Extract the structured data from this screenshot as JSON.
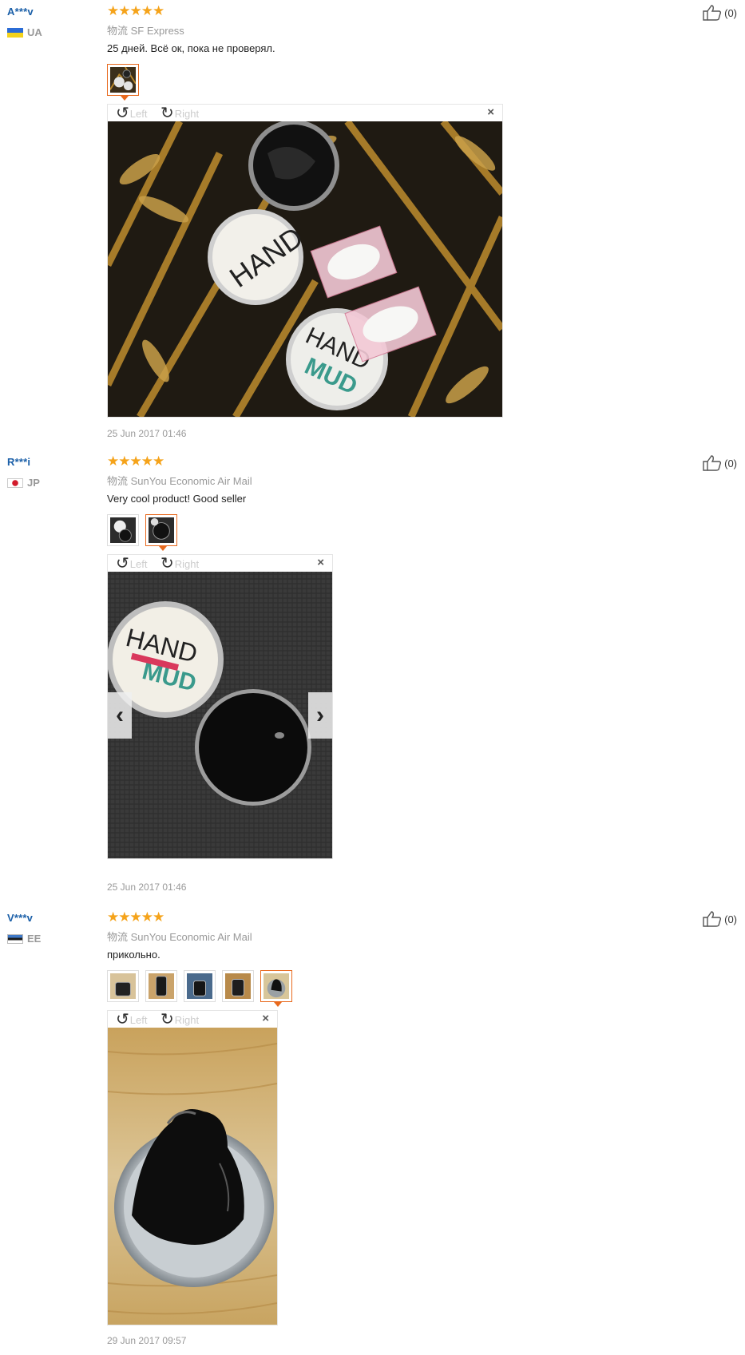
{
  "reviews": [
    {
      "user": "A***v",
      "country_code": "UA",
      "stars": "★★★★★",
      "logistics": "物流 SF Express",
      "comment": "25 дней. Всё ок, пока не проверял.",
      "date": "25 Jun 2017 01:46",
      "likes": "(0)",
      "thumbnail_count": 1,
      "active_thumbnail": 1
    },
    {
      "user": "R***i",
      "country_code": "JP",
      "stars": "★★★★★",
      "logistics": "物流 SunYou Economic Air Mail",
      "comment": "Very cool product! Good seller",
      "date": "25 Jun 2017 01:46",
      "likes": "(0)",
      "thumbnail_count": 2,
      "active_thumbnail": 2
    },
    {
      "user": "V***v",
      "country_code": "EE",
      "stars": "★★★★★",
      "logistics": "物流 SunYou Economic Air Mail",
      "comment": "прикольно.",
      "date": "29 Jun 2017 09:57",
      "likes": "(0)",
      "thumbnail_count": 5,
      "active_thumbnail": 5
    }
  ],
  "viewer": {
    "left_label": "Left",
    "right_label": "Right",
    "close_glyph": "×",
    "prev_glyph": "‹",
    "next_glyph": "›",
    "rotate_left_glyph": "↺",
    "rotate_right_glyph": "↻"
  },
  "colors": {
    "star": "#f5a31a",
    "username": "#1a5fa8",
    "active_border": "#e8691d"
  }
}
